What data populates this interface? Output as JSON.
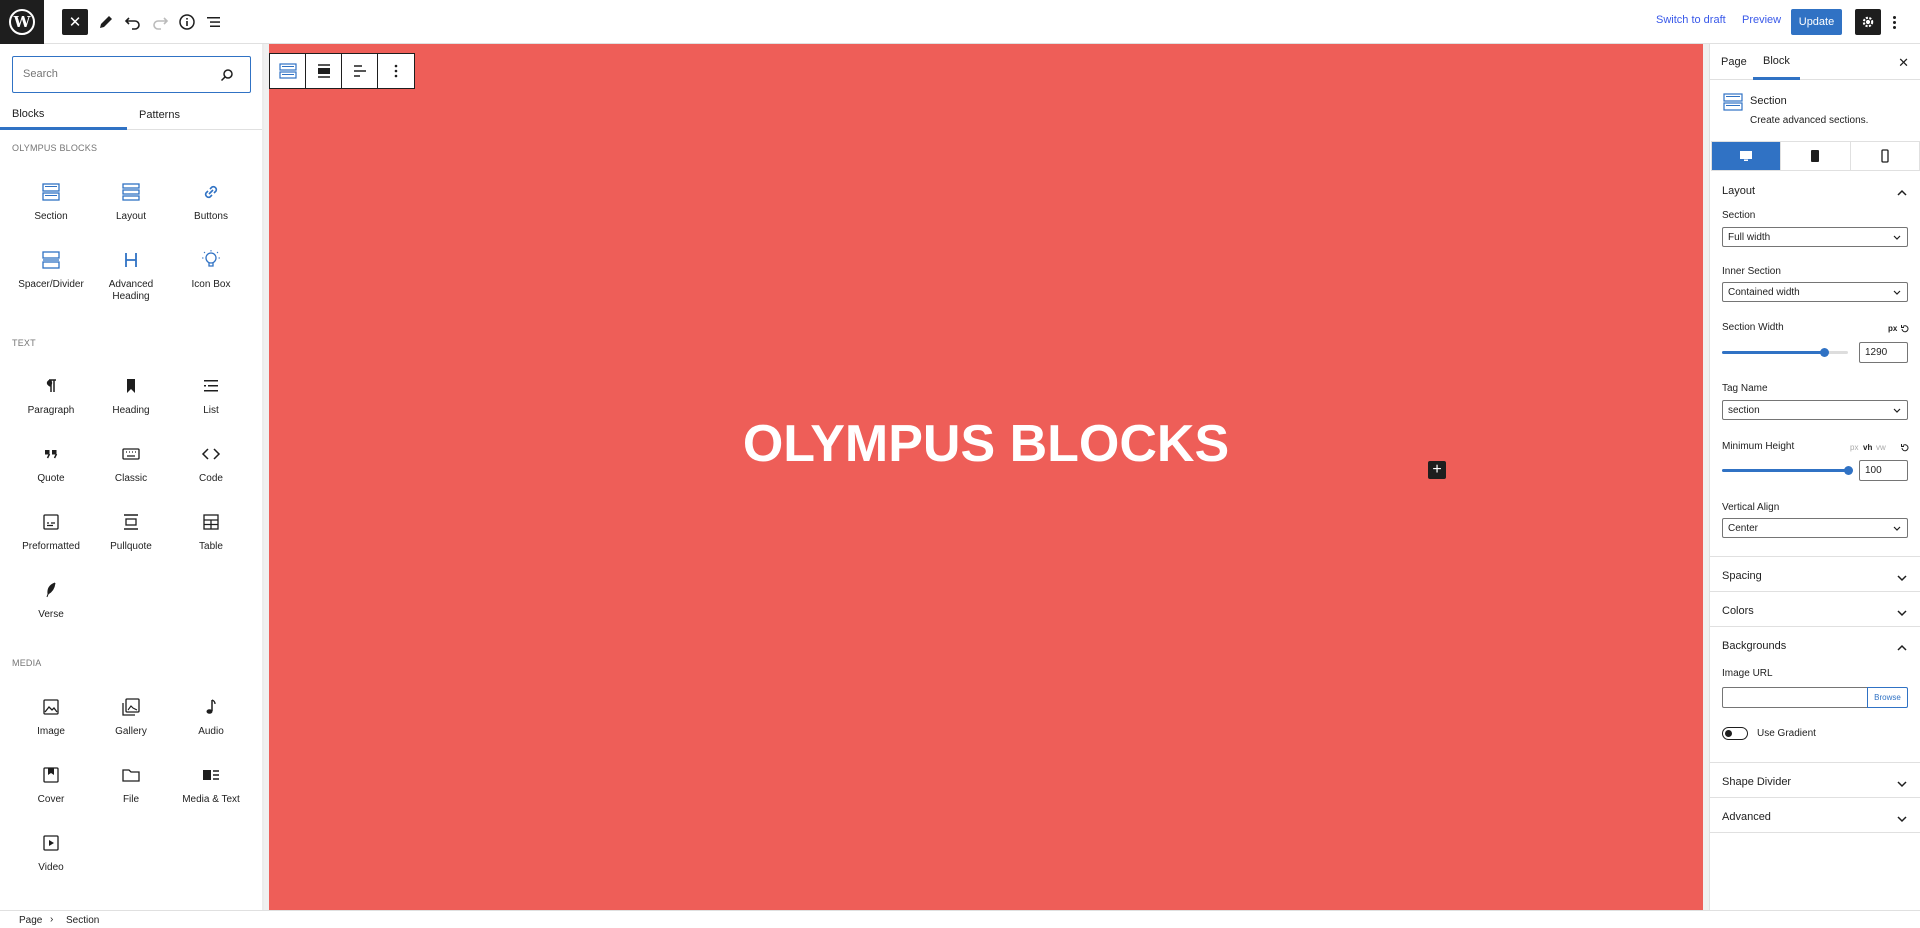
{
  "topbar": {
    "logo_letter": "W",
    "close_label": "✕",
    "switch_to_draft": "Switch to draft",
    "preview": "Preview",
    "update": "Update"
  },
  "inserter": {
    "search_placeholder": "Search",
    "tabs": [
      "Blocks",
      "Patterns"
    ],
    "categories": [
      {
        "title": "OLYMPUS BLOCKS",
        "blocks": [
          "Section",
          "Layout",
          "Buttons",
          "Spacer/Divider",
          "Advanced Heading",
          "Icon Box"
        ]
      },
      {
        "title": "TEXT",
        "blocks": [
          "Paragraph",
          "Heading",
          "List",
          "Quote",
          "Classic",
          "Code",
          "Preformatted",
          "Pullquote",
          "Table",
          "Verse"
        ]
      },
      {
        "title": "MEDIA",
        "blocks": [
          "Image",
          "Gallery",
          "Audio",
          "Cover",
          "File",
          "Media & Text",
          "Video"
        ]
      }
    ]
  },
  "canvas": {
    "hero_title": "OLYMPUS BLOCKS",
    "background_color": "#ee5e58"
  },
  "sidebar": {
    "tabs": [
      "Page",
      "Block"
    ],
    "block_card": {
      "title": "Section",
      "description": "Create advanced sections."
    },
    "layout": {
      "title": "Layout",
      "section_label": "Section",
      "section_value": "Full width",
      "inner_section_label": "Inner Section",
      "inner_section_value": "Contained width",
      "section_width_label": "Section Width",
      "section_width_unit": "px",
      "section_width_value": "1290",
      "section_width_fraction": 0.81,
      "tag_name_label": "Tag Name",
      "tag_name_value": "section",
      "min_height_label": "Minimum Height",
      "min_height_units": [
        "px",
        "vh",
        "vw"
      ],
      "min_height_value": "100",
      "min_height_fraction": 1.0,
      "vertical_align_label": "Vertical Align",
      "vertical_align_value": "Center"
    },
    "spacing": "Spacing",
    "colors": "Colors",
    "backgrounds": {
      "title": "Backgrounds",
      "image_url_label": "Image URL",
      "browse": "Browse",
      "use_gradient": "Use Gradient"
    },
    "shape_divider": "Shape Divider",
    "advanced": "Advanced"
  },
  "footer": {
    "breadcrumb": [
      "Page",
      "Section"
    ]
  },
  "colors": {
    "accent": "#3072c4",
    "canvas_red": "#ee5e58",
    "dark": "#1e1e1e"
  }
}
